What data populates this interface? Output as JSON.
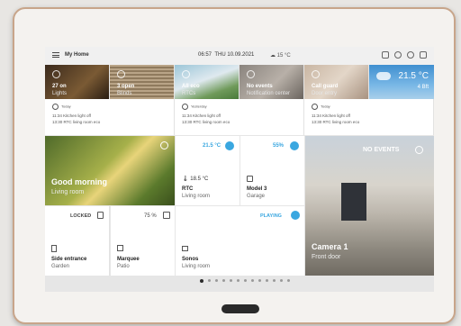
{
  "topbar": {
    "title": "My Home",
    "time": "06:57",
    "date": "THU 10.09.2021",
    "temperature": "15 °C"
  },
  "scenes": [
    {
      "label": "27 on",
      "sub": "Lights"
    },
    {
      "label": "3 open",
      "sub": "Blinds"
    },
    {
      "label": "All eco",
      "sub": "RTCs"
    },
    {
      "label": "No events",
      "sub": "Notification center"
    },
    {
      "label": "Call guard",
      "sub": "Door entry"
    }
  ],
  "weather": {
    "temp": "21.5 °C",
    "wind": "4 Bft"
  },
  "logs": [
    {
      "day": "Today",
      "line1": "11:34 Kitchen light off",
      "line2": "13:30 RTC living room eco"
    },
    {
      "day": "Yesterday",
      "line1": "11:34 Kitchen light off",
      "line2": "13:30 RTC living room eco"
    },
    {
      "day": "Today",
      "line1": "11:34 Kitchen light off",
      "line2": "13:30 RTC living room eco"
    }
  ],
  "good_morning": {
    "title": "Good morning",
    "room": "Living room"
  },
  "rtc": {
    "setpoint": "21.5 °C",
    "actual": "18.5 °C",
    "name": "RTC",
    "room": "Living room"
  },
  "model3": {
    "percent": "55%",
    "name": "Model 3",
    "room": "Garage"
  },
  "camera": {
    "status": "NO EVENTS",
    "name": "Camera 1",
    "room": "Front door"
  },
  "side_entrance": {
    "status": "LOCKED",
    "name": "Side entrance",
    "room": "Garden"
  },
  "marquee": {
    "percent": "75 %",
    "name": "Marquee",
    "room": "Patio"
  },
  "sonos": {
    "status": "PLAYING",
    "name": "Sonos",
    "room": "Living room"
  },
  "pager": {
    "count": 13,
    "active_index": 0
  },
  "colors": {
    "accent": "#3aa7e0",
    "frame": "#c8a58a"
  }
}
